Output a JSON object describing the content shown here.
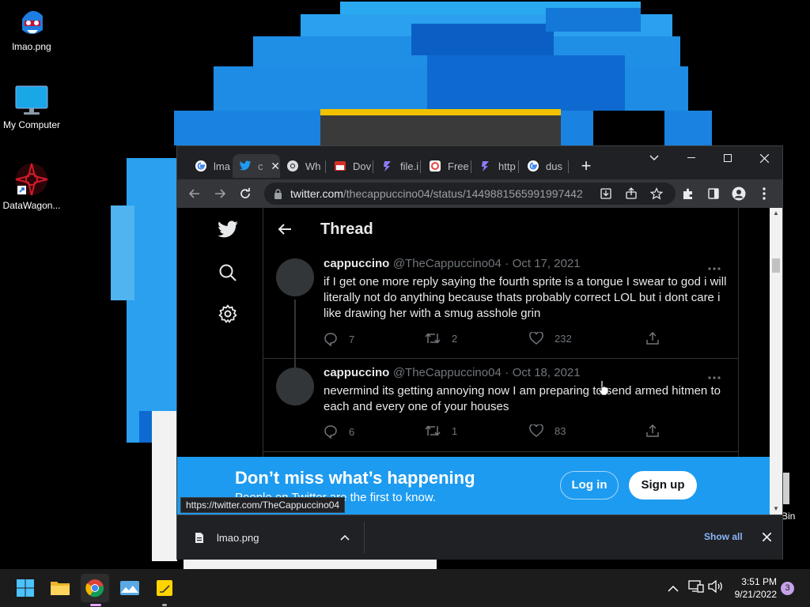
{
  "desktop": {
    "icons": [
      {
        "label": "lmao.png",
        "icon": "lmao-image-icon"
      },
      {
        "label": "My Computer",
        "icon": "monitor-icon"
      },
      {
        "label": "DataWagon...",
        "icon": "datawagon-shortcut-icon"
      }
    ],
    "recycle_bin_partial_label": "Bin"
  },
  "browser": {
    "tabs": [
      {
        "title": "lma",
        "icon": "google-icon",
        "active": false
      },
      {
        "title": "c",
        "icon": "twitter-icon",
        "active": true
      },
      {
        "title": "Wh",
        "icon": "chromium-icon",
        "active": false
      },
      {
        "title": "Dov",
        "icon": "store-icon",
        "active": false
      },
      {
        "title": "file.i",
        "icon": "purple-bolt-icon",
        "active": false
      },
      {
        "title": "Free",
        "icon": "red-circle-icon",
        "active": false
      },
      {
        "title": "http",
        "icon": "purple-bolt-icon",
        "active": false
      },
      {
        "title": "dus",
        "icon": "google-icon",
        "active": false
      }
    ],
    "new_tab_label": "+",
    "url_host": "twitter.com",
    "url_path": "/thecappuccino04/status/1449881565991997442",
    "status_link": "https://twitter.com/TheCappuccino04",
    "download": {
      "filename": "lmao.png",
      "show_all_label": "Show all"
    }
  },
  "twitter": {
    "header_title": "Thread",
    "tweets": [
      {
        "name": "cappuccino",
        "handle": "@TheCappuccino04",
        "sep": "·",
        "date": "Oct 17, 2021",
        "text": "if I get one more reply saying the fourth sprite is a tongue I swear to god i will    literally not do anything because thats probably correct LOL but i dont care i like drawing her with a smug asshole grin",
        "replies": "7",
        "retweets": "2",
        "likes": "232"
      },
      {
        "name": "cappuccino",
        "handle": "@TheCappuccino04",
        "sep": "·",
        "date": "Oct 18, 2021",
        "text": "nevermind its getting annoying now I am preparing to send armed hitmen to each and every one of your houses",
        "replies": "6",
        "retweets": "1",
        "likes": "83"
      }
    ],
    "banner": {
      "headline": "Don’t miss what’s happening",
      "subtext": "People on Twitter are the first to know.",
      "login_label": "Log in",
      "signup_label": "Sign up"
    }
  },
  "taskbar": {
    "time": "3:51 PM",
    "date": "9/21/2022",
    "notification_count": "3",
    "apps": [
      "windows-start-icon",
      "file-explorer-icon",
      "chrome-icon",
      "photos-icon",
      "sticky-notes-icon"
    ]
  },
  "colors": {
    "twitter_blue": "#1d9bf0",
    "wallpaper_blue": "#1e90e8",
    "wallpaper_light_blue": "#4fb4f0"
  }
}
